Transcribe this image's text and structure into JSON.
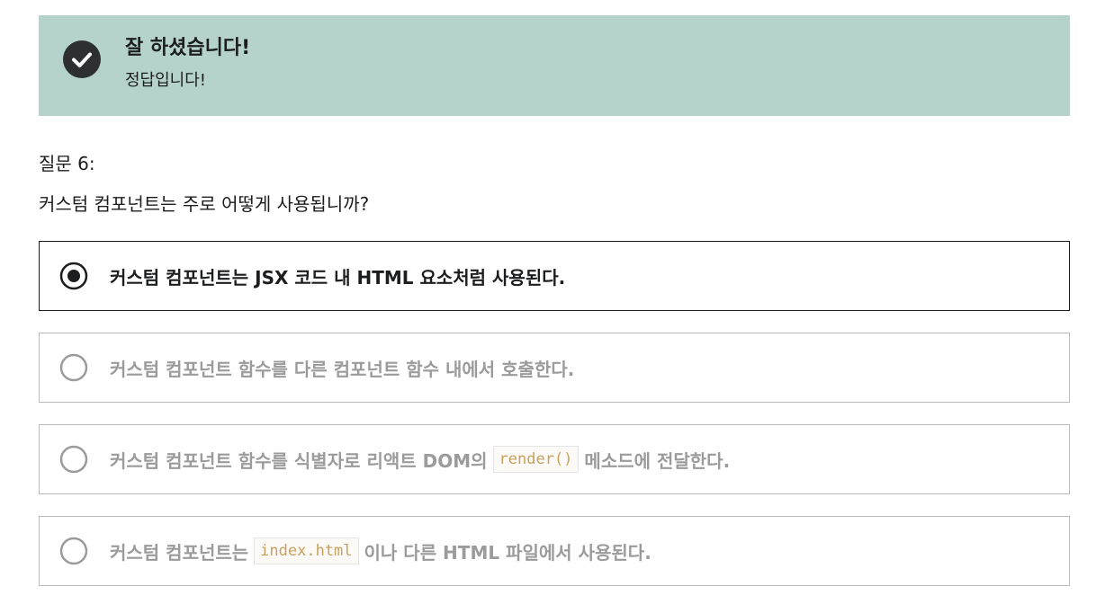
{
  "result": {
    "title": "잘 하셨습니다!",
    "subtitle": "정답입니다!",
    "icon": "check-circle-icon"
  },
  "question": {
    "number_label": "질문 6:",
    "text": "커스텀 컴포넌트는 주로 어떻게 사용됩니까?"
  },
  "options": [
    {
      "selected": true,
      "text_before": "커스텀 컴포넌트는 JSX 코드 내 HTML 요소처럼 사용된다.",
      "code": "",
      "text_after": ""
    },
    {
      "selected": false,
      "text_before": "커스텀 컴포넌트 함수를 다른 컴포넌트 함수 내에서 호출한다.",
      "code": "",
      "text_after": ""
    },
    {
      "selected": false,
      "text_before": "커스텀 컴포넌트 함수를 식별자로 리액트 DOM의",
      "code": "render()",
      "text_after": "메소드에 전달한다."
    },
    {
      "selected": false,
      "text_before": "커스텀 컴포넌트는",
      "code": "index.html",
      "text_after": "이나 다른 HTML 파일에서 사용된다."
    }
  ],
  "colors": {
    "banner_bg": "#b6d2cd",
    "icon_dark": "#2d2f31",
    "text_dark": "#1c1d1f",
    "text_muted": "#9b9b9b",
    "code_text": "#c9a15c"
  }
}
